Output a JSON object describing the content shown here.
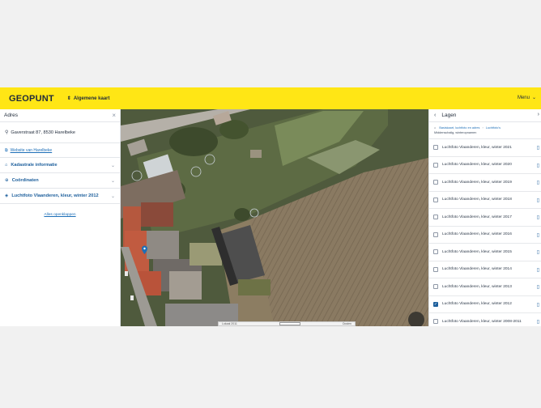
{
  "header": {
    "logo": "GEOPUNT",
    "map_switch_label": "Algemene kaart",
    "menu_label": "Menu"
  },
  "left_panel": {
    "title": "Adres",
    "address": "Gaverstraat 87, 8530 Harelbeke",
    "website_link": "Website van Harelbeke",
    "sections": [
      {
        "label": "Kadastrale informatie",
        "icon": "parcel-icon"
      },
      {
        "label": "Coördinaten",
        "icon": "crosshair-icon"
      },
      {
        "label": "Luchtfoto Vlaanderen, kleur, winter 2012",
        "icon": "layers-icon"
      }
    ],
    "open_all": "Alles openklappen"
  },
  "map": {
    "scale_left": "Lokaal 2011",
    "scale_right": "Oosten"
  },
  "right_panel": {
    "title": "Lagen",
    "breadcrumb": [
      "Basiskaart, luchtfoto en adres",
      "Luchtfoto's"
    ],
    "breadcrumb_current": "Middenschalig, winteropnamen",
    "layers": [
      {
        "label": "Luchtfoto Vlaanderen, kleur, winter 2021",
        "checked": false
      },
      {
        "label": "Luchtfoto Vlaanderen, kleur, winter 2020",
        "checked": false
      },
      {
        "label": "Luchtfoto Vlaanderen, kleur, winter 2019",
        "checked": false
      },
      {
        "label": "Luchtfoto Vlaanderen, kleur, winter 2018",
        "checked": false
      },
      {
        "label": "Luchtfoto Vlaanderen, kleur, winter 2017",
        "checked": false
      },
      {
        "label": "Luchtfoto Vlaanderen, kleur, winter 2016",
        "checked": false
      },
      {
        "label": "Luchtfoto Vlaanderen, kleur, winter 2015",
        "checked": false
      },
      {
        "label": "Luchtfoto Vlaanderen, kleur, winter 2014",
        "checked": false
      },
      {
        "label": "Luchtfoto Vlaanderen, kleur, winter 2013",
        "checked": false
      },
      {
        "label": "Luchtfoto Vlaanderen, kleur, winter 2012",
        "checked": true
      },
      {
        "label": "Luchtfoto Vlaanderen, kleur, winter 2008-2011",
        "checked": false
      }
    ]
  },
  "colors": {
    "header_bg": "#ffe615",
    "accent": "#1d5f9c",
    "link": "#1d6fb8"
  }
}
